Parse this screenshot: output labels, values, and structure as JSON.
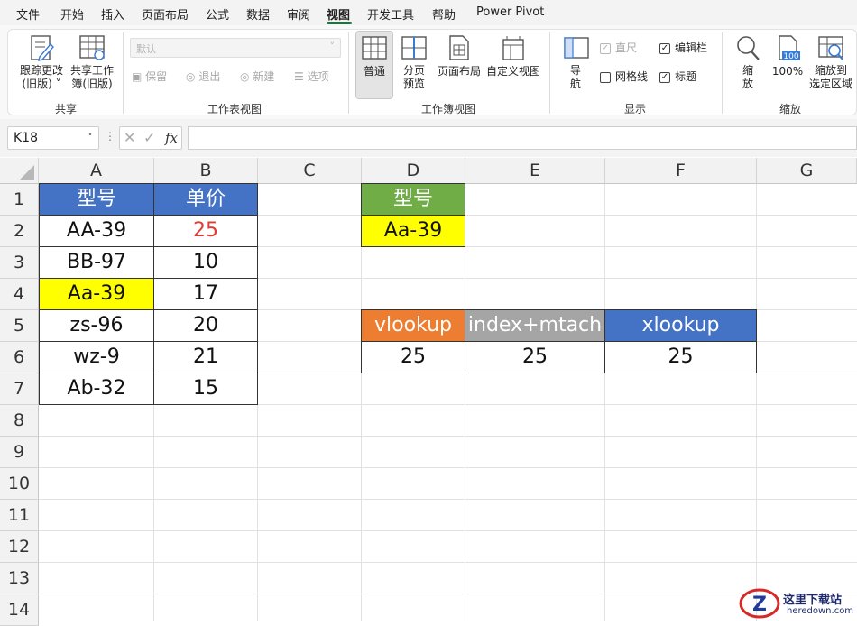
{
  "menu": [
    "文件",
    "开始",
    "插入",
    "页面布局",
    "公式",
    "数据",
    "审阅",
    "视图",
    "开发工具",
    "帮助",
    "Power Pivot"
  ],
  "ribbon": {
    "share": {
      "track_changes": [
        "跟踪更改",
        "(旧版)"
      ],
      "share_workbook": [
        "共享工作",
        "簿(旧版)"
      ],
      "group_label": "共享"
    },
    "sheet_view": {
      "style_value": "默认",
      "keep": "保留",
      "exit": "退出",
      "new": "新建",
      "options": "选项",
      "group_label": "工作表视图"
    },
    "workbook_views": {
      "normal": "普通",
      "page_break": [
        "分页",
        "预览"
      ],
      "page_layout": "页面布局",
      "custom_views": "自定义视图",
      "group_label": "工作簿视图"
    },
    "show": {
      "navigation": [
        "导",
        "航"
      ],
      "ruler": "直尺",
      "gridlines": "网格线",
      "formula_bar": "编辑栏",
      "headings": "标题",
      "group_label": "显示"
    },
    "zoom": {
      "zoom": [
        "缩",
        "放"
      ],
      "zoom_100": "100%",
      "zoom_selection": [
        "缩放到",
        "选定区域"
      ],
      "badge": "100",
      "group_label": "缩放"
    }
  },
  "formula_bar": {
    "name_box": "K18",
    "fx": "fx",
    "formula": ""
  },
  "columns": [
    "A",
    "B",
    "C",
    "D",
    "E",
    "F",
    "G"
  ],
  "rows": [
    "1",
    "2",
    "3",
    "4",
    "5",
    "6",
    "7",
    "8",
    "9",
    "10",
    "11",
    "12",
    "13",
    "14"
  ],
  "cells": {
    "a1": "型号",
    "b1": "单价",
    "a2": "AA-39",
    "b2": "25",
    "a3": "BB-97",
    "b3": "10",
    "a4": "Aa-39",
    "b4": "17",
    "a5": "zs-96",
    "b5": "20",
    "a6": "wz-9",
    "b6": "21",
    "a7": "Ab-32",
    "b7": "15",
    "d1": "型号",
    "d2": "Aa-39",
    "d5": "vlookup",
    "e5": "index+mtach",
    "f5": "xlookup",
    "d6": "25",
    "e6": "25",
    "f6": "25"
  },
  "colors": {
    "header_blue": "#4472c4",
    "header_green": "#70ad47",
    "highlight_yellow": "#ffff00",
    "vlookup_orange": "#ed7d31",
    "index_gray": "#a5a5a5",
    "red_value": "#e03c31",
    "accent_green": "#217346"
  },
  "watermark": {
    "text": "这里下载站",
    "url": "heredown.com"
  }
}
